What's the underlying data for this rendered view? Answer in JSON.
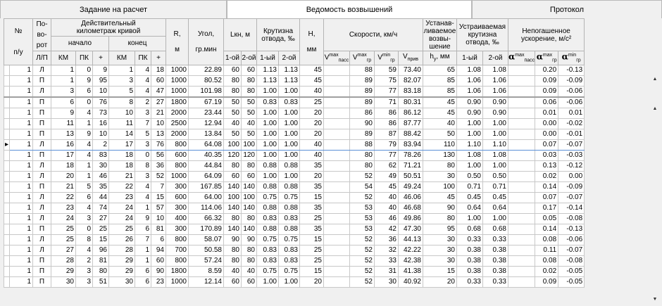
{
  "tabs": [
    "Задание на расчет",
    "Ведомость возвышений",
    "Протокол"
  ],
  "headers": {
    "num": [
      "№",
      "п/у"
    ],
    "turn": [
      "По-",
      "во-",
      "рот",
      "Л/П"
    ],
    "km_group": [
      "Действительный",
      "километраж кривой"
    ],
    "start": "начало",
    "end": "конец",
    "km": "КМ",
    "pk": "ПК",
    "plus": "+",
    "radius": [
      "R,",
      "м"
    ],
    "angle": [
      "Угол,",
      "гр.мин"
    ],
    "lkn": "Lкн, м",
    "first": "1-ой",
    "second": "2-ой",
    "steep": [
      "Крутизна",
      "отвода, ‰"
    ],
    "first2": "1-ый",
    "second2": "2-ой",
    "h": [
      "Н,",
      "мм"
    ],
    "speeds": "Скорости, км/ч",
    "v_main": "V",
    "sup_max": "max",
    "sup_min": "min",
    "sub_pass": "пасс",
    "sub_gr": "гр",
    "sub_priv": "прив",
    "hy": [
      "Устанав-",
      "ливаемое",
      "возвы-",
      "шение"
    ],
    "hy_unit": "h",
    "hy_sub": "у",
    "hy_mm": ", мм",
    "ust": [
      "Устраиваемая",
      "крутизна",
      "отвода, ‰"
    ],
    "accel": [
      "Непогашенное",
      "ускорение, м/с²"
    ],
    "alpha": "α"
  },
  "scroll": {
    "up": "▲",
    "down": "▼"
  },
  "row_marker": "▸",
  "rows": [
    [
      "1",
      "Л",
      "1",
      "0",
      "9",
      "1",
      "4",
      "18",
      "1000",
      "22.89",
      "60",
      "60",
      "1.13",
      "1.13",
      "45",
      "",
      "88",
      "59",
      "73.40",
      "65",
      "1.08",
      "1.08",
      "",
      "0.20",
      "-0.13"
    ],
    [
      "1",
      "П",
      "1",
      "9",
      "95",
      "3",
      "4",
      "60",
      "1000",
      "80.52",
      "80",
      "80",
      "1.13",
      "1.13",
      "45",
      "",
      "89",
      "75",
      "82.07",
      "85",
      "1.06",
      "1.06",
      "",
      "0.09",
      "-0.09"
    ],
    [
      "1",
      "Л",
      "3",
      "6",
      "10",
      "5",
      "4",
      "47",
      "1000",
      "101.98",
      "80",
      "80",
      "1.00",
      "1.00",
      "40",
      "",
      "89",
      "77",
      "83.18",
      "85",
      "1.06",
      "1.06",
      "",
      "0.09",
      "-0.06"
    ],
    [
      "1",
      "П",
      "6",
      "0",
      "76",
      "8",
      "2",
      "27",
      "1800",
      "67.19",
      "50",
      "50",
      "0.83",
      "0.83",
      "25",
      "",
      "89",
      "71",
      "80.31",
      "45",
      "0.90",
      "0.90",
      "",
      "0.06",
      "-0.06"
    ],
    [
      "1",
      "П",
      "9",
      "4",
      "73",
      "10",
      "3",
      "21",
      "2000",
      "23.44",
      "50",
      "50",
      "1.00",
      "1.00",
      "20",
      "",
      "86",
      "86",
      "86.12",
      "45",
      "0.90",
      "0.90",
      "",
      "0.01",
      "0.01"
    ],
    [
      "1",
      "П",
      "11",
      "1",
      "16",
      "11",
      "7",
      "10",
      "2500",
      "12.94",
      "40",
      "40",
      "1.00",
      "1.00",
      "20",
      "",
      "90",
      "86",
      "87.77",
      "40",
      "1.00",
      "1.00",
      "",
      "0.00",
      "-0.02"
    ],
    [
      "1",
      "П",
      "13",
      "9",
      "10",
      "14",
      "5",
      "13",
      "2000",
      "13.84",
      "50",
      "50",
      "1.00",
      "1.00",
      "20",
      "",
      "89",
      "87",
      "88.42",
      "50",
      "1.00",
      "1.00",
      "",
      "0.00",
      "-0.01"
    ],
    [
      "1",
      "Л",
      "16",
      "4",
      "2",
      "17",
      "3",
      "76",
      "800",
      "64.08",
      "100",
      "100",
      "1.00",
      "1.00",
      "40",
      "",
      "88",
      "79",
      "83.94",
      "110",
      "1.10",
      "1.10",
      "",
      "0.07",
      "-0.07"
    ],
    [
      "1",
      "П",
      "17",
      "4",
      "83",
      "18",
      "0",
      "56",
      "600",
      "40.35",
      "120",
      "120",
      "1.00",
      "1.00",
      "40",
      "",
      "80",
      "77",
      "78.26",
      "130",
      "1.08",
      "1.08",
      "",
      "0.03",
      "-0.03"
    ],
    [
      "1",
      "Л",
      "18",
      "1",
      "30",
      "18",
      "8",
      "36",
      "800",
      "44.84",
      "80",
      "80",
      "0.88",
      "0.88",
      "35",
      "",
      "80",
      "62",
      "71.21",
      "80",
      "1.00",
      "1.00",
      "",
      "0.13",
      "-0.12"
    ],
    [
      "1",
      "Л",
      "20",
      "1",
      "46",
      "21",
      "3",
      "52",
      "1000",
      "64.09",
      "60",
      "60",
      "1.00",
      "1.00",
      "20",
      "",
      "52",
      "49",
      "50.51",
      "30",
      "0.50",
      "0.50",
      "",
      "0.02",
      "0.00"
    ],
    [
      "1",
      "П",
      "21",
      "5",
      "35",
      "22",
      "4",
      "7",
      "300",
      "167.85",
      "140",
      "140",
      "0.88",
      "0.88",
      "35",
      "",
      "54",
      "45",
      "49.24",
      "100",
      "0.71",
      "0.71",
      "",
      "0.14",
      "-0.09"
    ],
    [
      "1",
      "Л",
      "22",
      "6",
      "44",
      "23",
      "4",
      "15",
      "600",
      "64.00",
      "100",
      "100",
      "0.75",
      "0.75",
      "15",
      "",
      "52",
      "40",
      "46.06",
      "45",
      "0.45",
      "0.45",
      "",
      "0.07",
      "-0.07"
    ],
    [
      "1",
      "Л",
      "23",
      "4",
      "74",
      "24",
      "1",
      "57",
      "300",
      "114.06",
      "140",
      "140",
      "0.88",
      "0.88",
      "35",
      "",
      "53",
      "40",
      "46.68",
      "90",
      "0.64",
      "0.64",
      "",
      "0.17",
      "-0.14"
    ],
    [
      "1",
      "Л",
      "24",
      "3",
      "27",
      "24",
      "9",
      "10",
      "400",
      "66.32",
      "80",
      "80",
      "0.83",
      "0.83",
      "25",
      "",
      "53",
      "46",
      "49.86",
      "80",
      "1.00",
      "1.00",
      "",
      "0.05",
      "-0.08"
    ],
    [
      "1",
      "П",
      "25",
      "0",
      "25",
      "25",
      "6",
      "81",
      "300",
      "170.89",
      "140",
      "140",
      "0.88",
      "0.88",
      "35",
      "",
      "53",
      "42",
      "47.30",
      "95",
      "0.68",
      "0.68",
      "",
      "0.14",
      "-0.13"
    ],
    [
      "1",
      "Л",
      "25",
      "8",
      "15",
      "26",
      "7",
      "6",
      "800",
      "58.07",
      "90",
      "90",
      "0.75",
      "0.75",
      "15",
      "",
      "52",
      "36",
      "44.13",
      "30",
      "0.33",
      "0.33",
      "",
      "0.08",
      "-0.06"
    ],
    [
      "1",
      "Л",
      "27",
      "4",
      "96",
      "28",
      "1",
      "94",
      "700",
      "50.58",
      "80",
      "80",
      "0.83",
      "0.83",
      "25",
      "",
      "52",
      "32",
      "42.22",
      "30",
      "0.38",
      "0.38",
      "",
      "0.11",
      "-0.07"
    ],
    [
      "1",
      "П",
      "28",
      "2",
      "81",
      "29",
      "1",
      "60",
      "800",
      "57.24",
      "80",
      "80",
      "0.83",
      "0.83",
      "25",
      "",
      "52",
      "33",
      "42.38",
      "30",
      "0.38",
      "0.38",
      "",
      "0.08",
      "-0.08"
    ],
    [
      "1",
      "П",
      "29",
      "3",
      "80",
      "29",
      "6",
      "90",
      "1800",
      "8.59",
      "40",
      "40",
      "0.75",
      "0.75",
      "15",
      "",
      "52",
      "31",
      "41.38",
      "15",
      "0.38",
      "0.38",
      "",
      "0.02",
      "-0.05"
    ],
    [
      "1",
      "П",
      "30",
      "3",
      "51",
      "30",
      "6",
      "23",
      "1000",
      "12.14",
      "60",
      "60",
      "1.00",
      "1.00",
      "20",
      "",
      "52",
      "30",
      "40.92",
      "20",
      "0.33",
      "0.33",
      "",
      "0.09",
      "-0.05"
    ]
  ]
}
